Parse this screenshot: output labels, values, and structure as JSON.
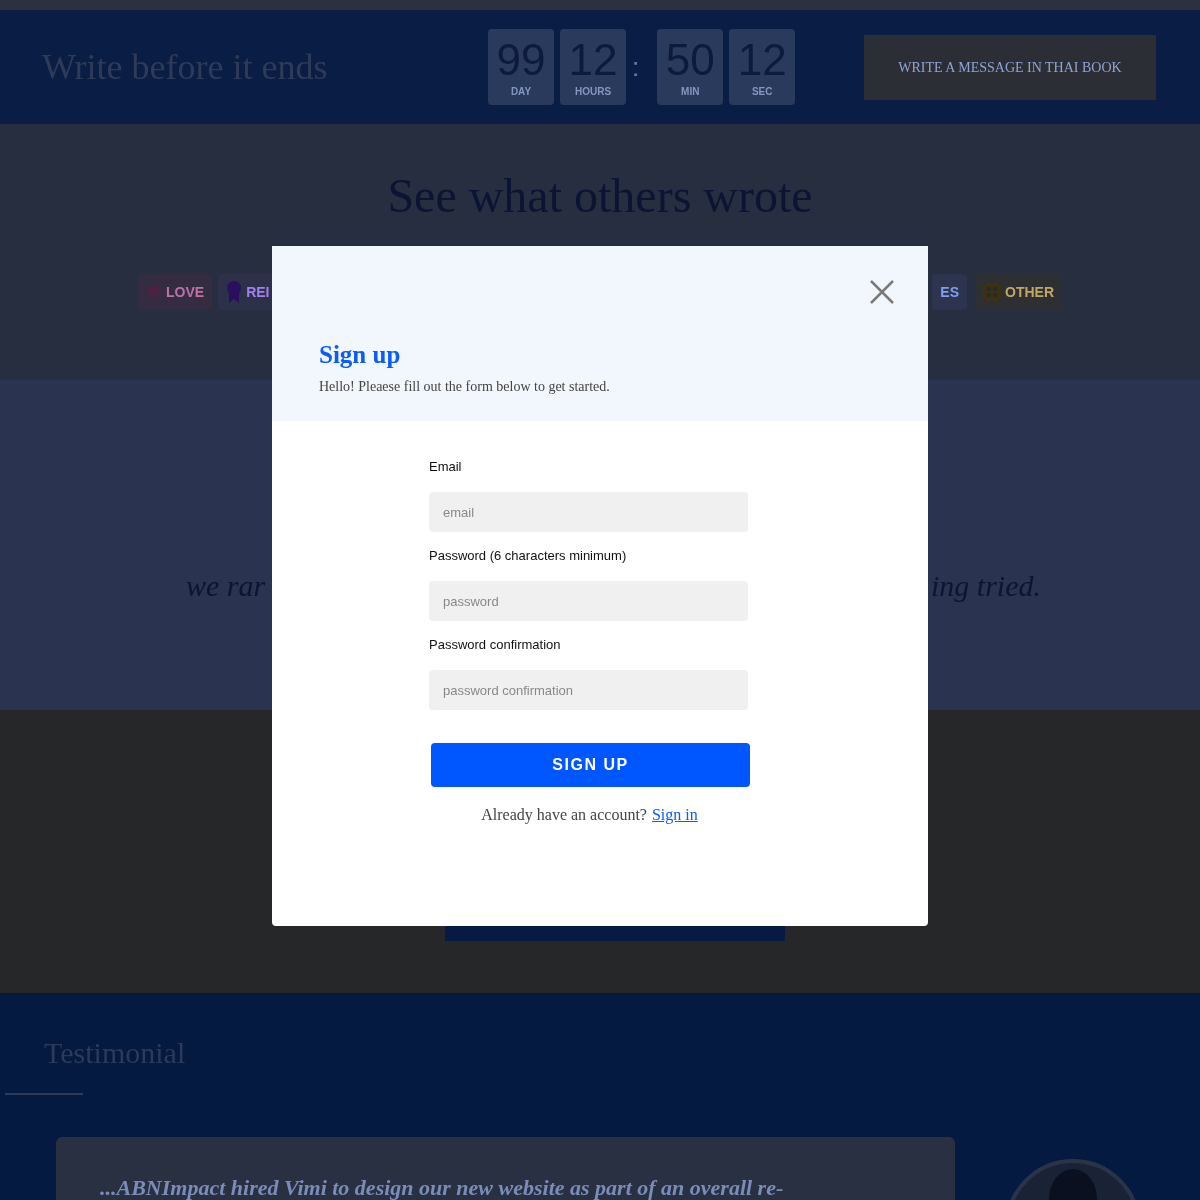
{
  "header": {
    "title": "Write before it ends",
    "countdown": [
      {
        "value": "99",
        "unit": "DAY"
      },
      {
        "value": "12",
        "unit": "HOURS"
      },
      {
        "value": "50",
        "unit": "MIN"
      },
      {
        "value": "12",
        "unit": "SEC"
      }
    ],
    "separator": ":",
    "cta": "WRITE A MESSAGE IN THAI BOOK"
  },
  "others": {
    "title": "See what others wrote",
    "filters_left": [
      {
        "label": "LOVE",
        "kind": "heart"
      },
      {
        "label": "REI",
        "kind": "ribbon"
      }
    ],
    "filters_right": [
      {
        "label": "ES",
        "kind": "plain"
      },
      {
        "label": "OTHER",
        "kind": "grid"
      }
    ]
  },
  "quote": {
    "left": "we rar",
    "right": "ing tried."
  },
  "testimonial": {
    "title": "Testimonial",
    "quote": "...ABNImpact hired Vimi to design our new website as part of an overall re-"
  },
  "modal": {
    "title": "Sign up",
    "subtitle": "Hello! Pleaese fill out the form below to get started.",
    "fields": [
      {
        "label": "Email",
        "placeholder": "email"
      },
      {
        "label": "Password (6 characters minimum)",
        "placeholder": "password"
      },
      {
        "label": "Password confirmation",
        "placeholder": "password confirmation"
      }
    ],
    "submit": "SIGN UP",
    "footer_text": "Already have an account?",
    "footer_link": "Sign in"
  }
}
